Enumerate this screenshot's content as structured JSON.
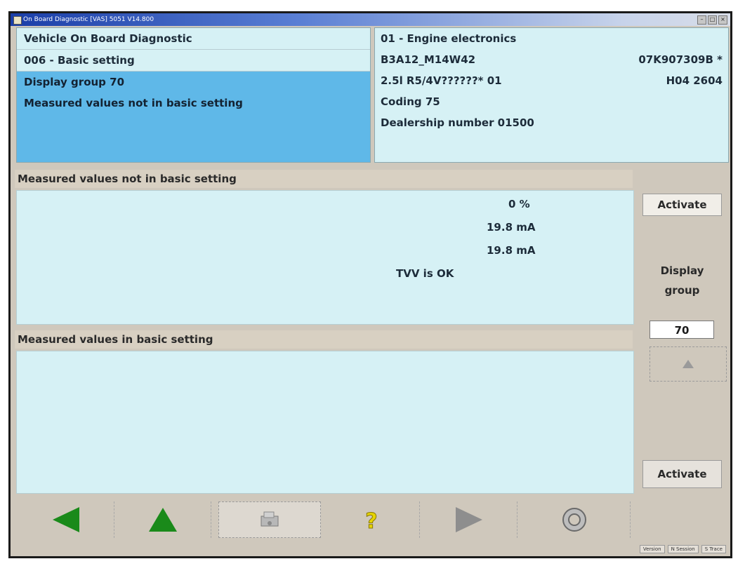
{
  "window": {
    "title": "On Board Diagnostic [VAS] 5051 V14.800"
  },
  "header": {
    "left": {
      "line1": "Vehicle On Board Diagnostic",
      "line2": "006 - Basic setting",
      "line3": "Display group 70",
      "line4": "Measured values not in basic setting"
    },
    "right": {
      "line1": "01 - Engine electronics",
      "line2_left": "B3A12_M14W42",
      "line2_right": "07K907309B *",
      "line3_left": "2.5l R5/4V??????* 01",
      "line3_right": "H04 2604",
      "line4": "Coding 75",
      "line5": "Dealership number 01500"
    }
  },
  "sections": {
    "not_basic": {
      "label": "Measured values not in basic setting",
      "values": [
        "0 %",
        "19.8 mA",
        "19.8 mA",
        "TVV is OK"
      ]
    },
    "basic": {
      "label": "Measured values in basic setting"
    }
  },
  "side": {
    "activate_top": "Activate",
    "display_group_label": "Display group",
    "display_group_value": "70",
    "activate_bottom": "Activate"
  },
  "toolbar": {
    "icons": [
      "back-arrow-icon",
      "up-arrow-icon",
      "print-icon",
      "help-icon",
      "forward-arrow-icon",
      "settings-icon"
    ]
  },
  "status": {
    "items": [
      "Version",
      "N Session",
      "S Trace"
    ]
  },
  "colors": {
    "panel_light": "#d6f1f5",
    "panel_selected": "#5fb8e8",
    "chrome": "#cfc8bc",
    "green_arrow": "#1a8a1a",
    "help_yellow": "#e6d400"
  }
}
